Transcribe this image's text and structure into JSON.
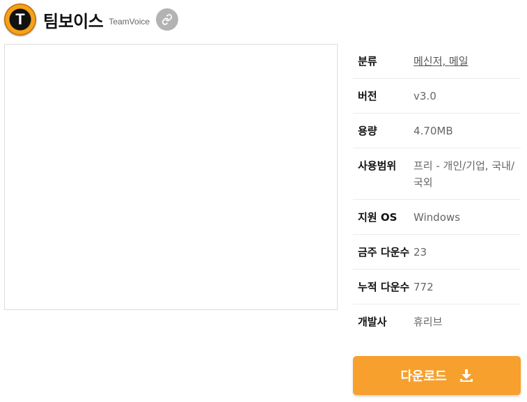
{
  "app": {
    "icon_letter": "T",
    "title": "팀보이스",
    "subtitle": "TeamVoice"
  },
  "info": [
    {
      "key": "분류",
      "value": "메신저, 메일"
    },
    {
      "key": "버전",
      "value": "v3.0"
    },
    {
      "key": "용량",
      "value": "4.70MB"
    },
    {
      "key": "사용범위",
      "value": "프리 - 개인/기업, 국내/국외"
    },
    {
      "key": "지원 OS",
      "value": "Windows"
    },
    {
      "key": "금주 다운수",
      "value": "23"
    },
    {
      "key": "누적 다운수",
      "value": "772"
    },
    {
      "key": "개발사",
      "value": "휴리브"
    }
  ],
  "download": {
    "label": "다운로드"
  },
  "colors": {
    "accent": "#f7a02d",
    "icon_ring": "#f5a11a",
    "link_button": "#b3b3b3"
  }
}
